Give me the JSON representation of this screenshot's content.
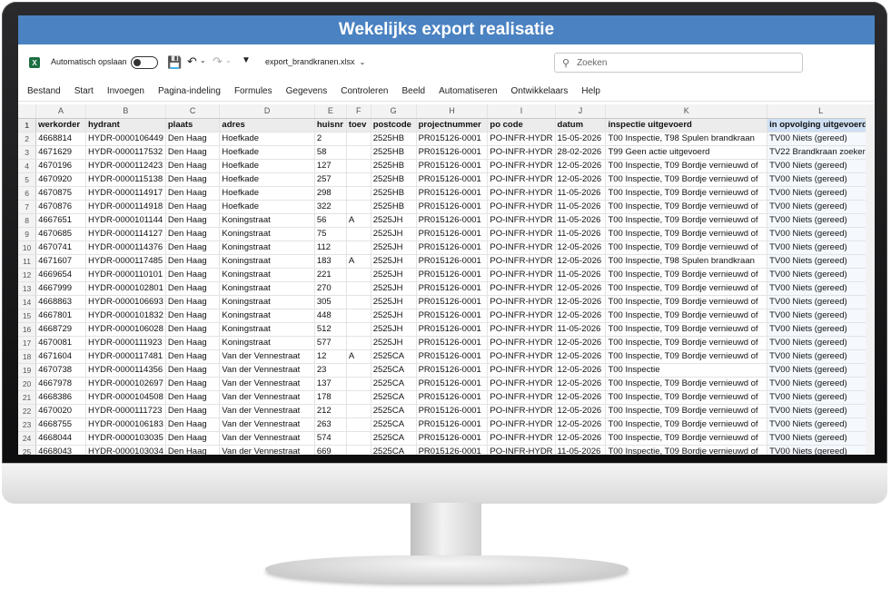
{
  "window": {
    "title": "Wekelijks export realisatie"
  },
  "toolbar": {
    "autosave_label": "Automatisch opslaan",
    "file_name": "export_brandkranen.xlsx",
    "search_placeholder": "Zoeken",
    "excel_letter": "X"
  },
  "menu": [
    "Bestand",
    "Start",
    "Invoegen",
    "Pagina-indeling",
    "Formules",
    "Gegevens",
    "Controleren",
    "Beeld",
    "Automatiseren",
    "Ontwikkelaars",
    "Help"
  ],
  "columns": [
    "A",
    "B",
    "C",
    "D",
    "E",
    "F",
    "G",
    "H",
    "I",
    "J",
    "K",
    "L"
  ],
  "header_row": [
    "werkorder",
    "hydrant",
    "plaats",
    "adres",
    "huisnr",
    "toev",
    "postcode",
    "projectnummer",
    "po code",
    "datum",
    "inspectie uitgevoerd",
    "in opvolging uitgevoerd"
  ],
  "rows": [
    [
      "4668814",
      "HYDR-0000106449",
      "Den Haag",
      "Hoefkade",
      "2",
      "",
      "2525HB",
      "PR015126-0001",
      "PO-INFR-HYDR",
      "15-05-2026",
      "T00 Inspectie, T98 Spulen brandkraan",
      "TV00 Niets (gereed)"
    ],
    [
      "4671629",
      "HYDR-0000117532",
      "Den Haag",
      "Hoefkade",
      "58",
      "",
      "2525HB",
      "PR015126-0001",
      "PO-INFR-HYDR",
      "28-02-2026",
      "T99 Geen actie uitgevoerd",
      "TV22 Brandkraan zoeken"
    ],
    [
      "4670196",
      "HYDR-0000112423",
      "Den Haag",
      "Hoefkade",
      "127",
      "",
      "2525HB",
      "PR015126-0001",
      "PO-INFR-HYDR",
      "12-05-2026",
      "T00 Inspectie, T09 Bordje vernieuwd of",
      "TV00 Niets (gereed)"
    ],
    [
      "4670920",
      "HYDR-0000115138",
      "Den Haag",
      "Hoefkade",
      "257",
      "",
      "2525HB",
      "PR015126-0001",
      "PO-INFR-HYDR",
      "12-05-2026",
      "T00 Inspectie, T09 Bordje vernieuwd of",
      "TV00 Niets (gereed)"
    ],
    [
      "4670875",
      "HYDR-0000114917",
      "Den Haag",
      "Hoefkade",
      "298",
      "",
      "2525HB",
      "PR015126-0001",
      "PO-INFR-HYDR",
      "11-05-2026",
      "T00 Inspectie, T09 Bordje vernieuwd of",
      "TV00 Niets (gereed)"
    ],
    [
      "4670876",
      "HYDR-0000114918",
      "Den Haag",
      "Hoefkade",
      "322",
      "",
      "2525HB",
      "PR015126-0001",
      "PO-INFR-HYDR",
      "11-05-2026",
      "T00 Inspectie, T09 Bordje vernieuwd of",
      "TV00 Niets (gereed)"
    ],
    [
      "4667651",
      "HYDR-0000101144",
      "Den Haag",
      "Koningstraat",
      "56",
      "A",
      "2525JH",
      "PR015126-0001",
      "PO-INFR-HYDR",
      "11-05-2026",
      "T00 Inspectie, T09 Bordje vernieuwd of",
      "TV00 Niets (gereed)"
    ],
    [
      "4670685",
      "HYDR-0000114127",
      "Den Haag",
      "Koningstraat",
      "75",
      "",
      "2525JH",
      "PR015126-0001",
      "PO-INFR-HYDR",
      "11-05-2026",
      "T00 Inspectie, T09 Bordje vernieuwd of",
      "TV00 Niets (gereed)"
    ],
    [
      "4670741",
      "HYDR-0000114376",
      "Den Haag",
      "Koningstraat",
      "112",
      "",
      "2525JH",
      "PR015126-0001",
      "PO-INFR-HYDR",
      "12-05-2026",
      "T00 Inspectie, T09 Bordje vernieuwd of",
      "TV00 Niets (gereed)"
    ],
    [
      "4671607",
      "HYDR-0000117485",
      "Den Haag",
      "Koningstraat",
      "183",
      "A",
      "2525JH",
      "PR015126-0001",
      "PO-INFR-HYDR",
      "12-05-2026",
      "T00 Inspectie, T98 Spulen brandkraan",
      "TV00 Niets (gereed)"
    ],
    [
      "4669654",
      "HYDR-0000110101",
      "Den Haag",
      "Koningstraat",
      "221",
      "",
      "2525JH",
      "PR015126-0001",
      "PO-INFR-HYDR",
      "11-05-2026",
      "T00 Inspectie, T09 Bordje vernieuwd of",
      "TV00 Niets (gereed)"
    ],
    [
      "4667999",
      "HYDR-0000102801",
      "Den Haag",
      "Koningstraat",
      "270",
      "",
      "2525JH",
      "PR015126-0001",
      "PO-INFR-HYDR",
      "12-05-2026",
      "T00 Inspectie, T09 Bordje vernieuwd of",
      "TV00 Niets (gereed)"
    ],
    [
      "4668863",
      "HYDR-0000106693",
      "Den Haag",
      "Koningstraat",
      "305",
      "",
      "2525JH",
      "PR015126-0001",
      "PO-INFR-HYDR",
      "12-05-2026",
      "T00 Inspectie, T09 Bordje vernieuwd of",
      "TV00 Niets (gereed)"
    ],
    [
      "4667801",
      "HYDR-0000101832",
      "Den Haag",
      "Koningstraat",
      "448",
      "",
      "2525JH",
      "PR015126-0001",
      "PO-INFR-HYDR",
      "12-05-2026",
      "T00 Inspectie, T09 Bordje vernieuwd of",
      "TV00 Niets (gereed)"
    ],
    [
      "4668729",
      "HYDR-0000106028",
      "Den Haag",
      "Koningstraat",
      "512",
      "",
      "2525JH",
      "PR015126-0001",
      "PO-INFR-HYDR",
      "11-05-2026",
      "T00 Inspectie, T09 Bordje vernieuwd of",
      "TV00 Niets (gereed)"
    ],
    [
      "4670081",
      "HYDR-0000111923",
      "Den Haag",
      "Koningstraat",
      "577",
      "",
      "2525JH",
      "PR015126-0001",
      "PO-INFR-HYDR",
      "12-05-2026",
      "T00 Inspectie, T09 Bordje vernieuwd of",
      "TV00 Niets (gereed)"
    ],
    [
      "4671604",
      "HYDR-0000117481",
      "Den Haag",
      "Van der Vennestraat",
      "12",
      "A",
      "2525CA",
      "PR015126-0001",
      "PO-INFR-HYDR",
      "12-05-2026",
      "T00 Inspectie, T09 Bordje vernieuwd of",
      "TV00 Niets (gereed)"
    ],
    [
      "4670738",
      "HYDR-0000114356",
      "Den Haag",
      "Van der Vennestraat",
      "23",
      "",
      "2525CA",
      "PR015126-0001",
      "PO-INFR-HYDR",
      "12-05-2026",
      "T00 Inspectie",
      "TV00 Niets (gereed)"
    ],
    [
      "4667978",
      "HYDR-0000102697",
      "Den Haag",
      "Van der Vennestraat",
      "137",
      "",
      "2525CA",
      "PR015126-0001",
      "PO-INFR-HYDR",
      "12-05-2026",
      "T00 Inspectie, T09 Bordje vernieuwd of",
      "TV00 Niets (gereed)"
    ],
    [
      "4668386",
      "HYDR-0000104508",
      "Den Haag",
      "Van der Vennestraat",
      "178",
      "",
      "2525CA",
      "PR015126-0001",
      "PO-INFR-HYDR",
      "12-05-2026",
      "T00 Inspectie, T09 Bordje vernieuwd of",
      "TV00 Niets (gereed)"
    ],
    [
      "4670020",
      "HYDR-0000111723",
      "Den Haag",
      "Van der Vennestraat",
      "212",
      "",
      "2525CA",
      "PR015126-0001",
      "PO-INFR-HYDR",
      "12-05-2026",
      "T00 Inspectie, T09 Bordje vernieuwd of",
      "TV00 Niets (gereed)"
    ],
    [
      "4668755",
      "HYDR-0000106183",
      "Den Haag",
      "Van der Vennestraat",
      "263",
      "",
      "2525CA",
      "PR015126-0001",
      "PO-INFR-HYDR",
      "12-05-2026",
      "T00 Inspectie, T09 Bordje vernieuwd of",
      "TV00 Niets (gereed)"
    ],
    [
      "4668044",
      "HYDR-0000103035",
      "Den Haag",
      "Van der Vennestraat",
      "574",
      "",
      "2525CA",
      "PR015126-0001",
      "PO-INFR-HYDR",
      "12-05-2026",
      "T00 Inspectie, T09 Bordje vernieuwd of",
      "TV00 Niets (gereed)"
    ],
    [
      "4668043",
      "HYDR-0000103034",
      "Den Haag",
      "Van der Vennestraat",
      "669",
      "",
      "2525CA",
      "PR015126-0001",
      "PO-INFR-HYDR",
      "11-05-2026",
      "T00 Inspectie, T09 Bordje vernieuwd of",
      "TV00 Niets (gereed)"
    ]
  ],
  "colors": {
    "title_bar": "#4a82c2",
    "excel_green": "#1d6f42",
    "selected_col": "#cfe0f4"
  }
}
